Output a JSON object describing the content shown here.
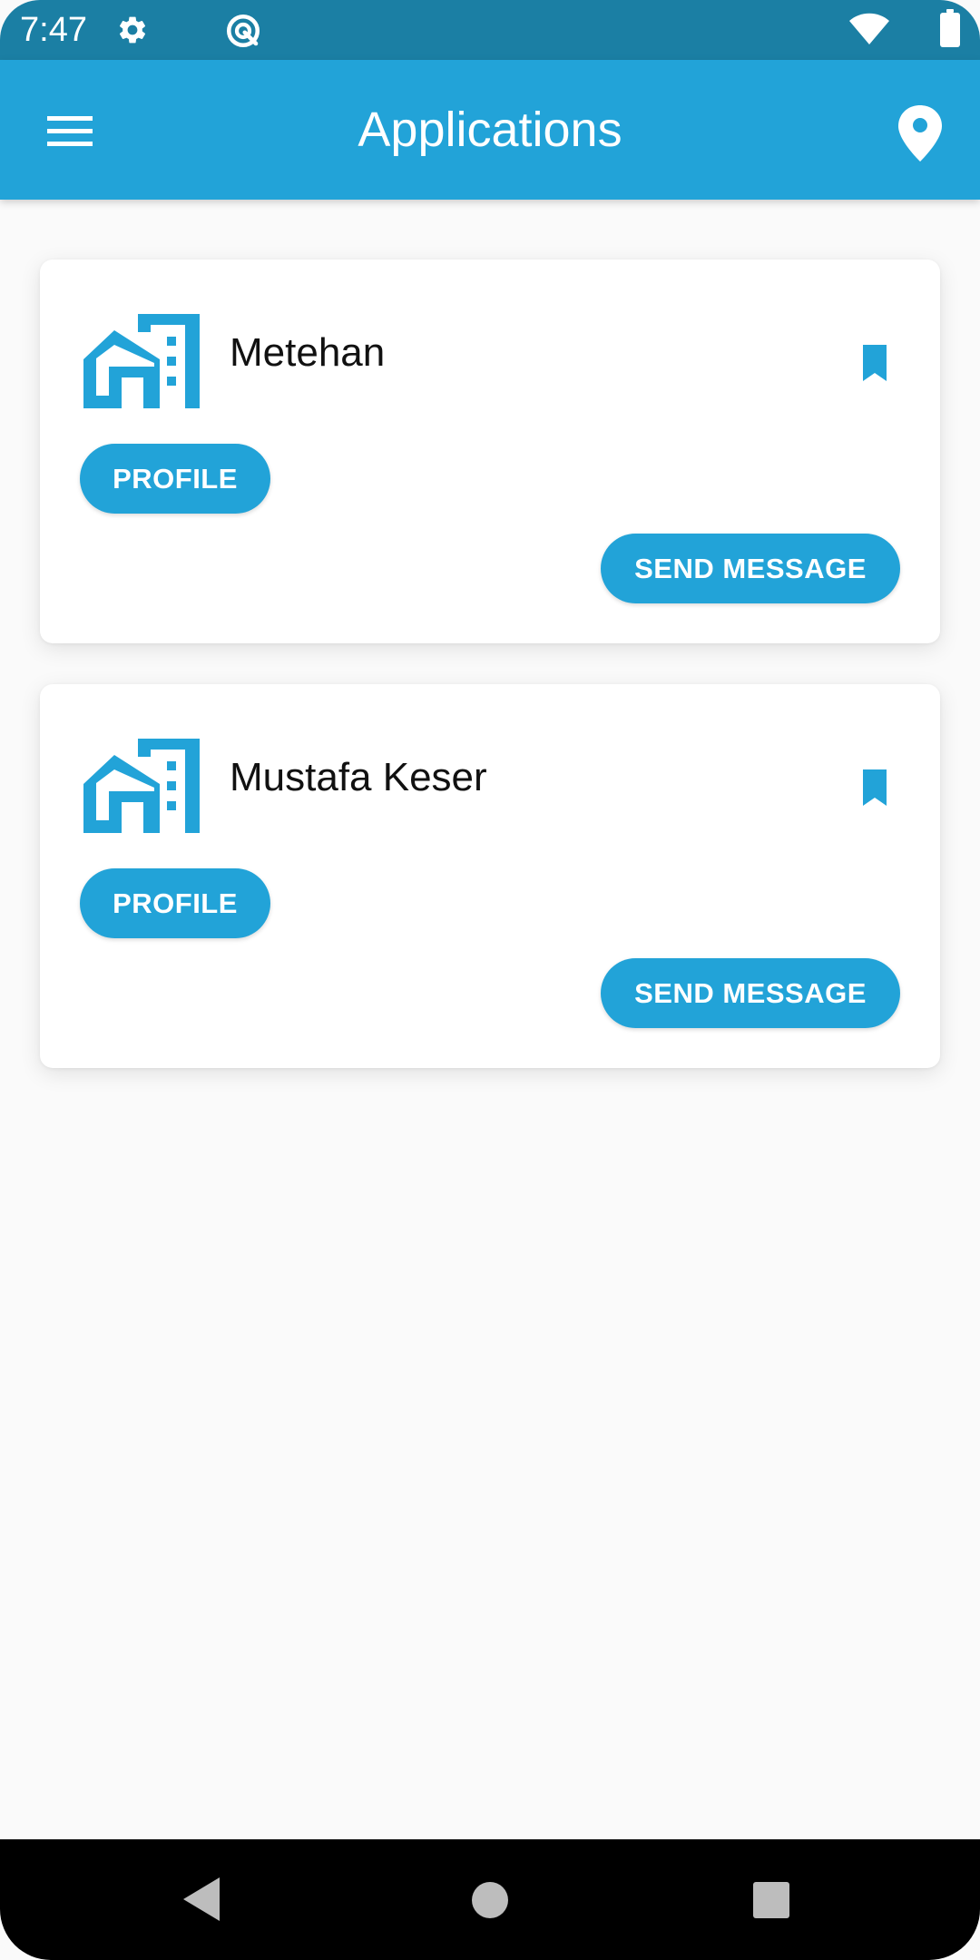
{
  "status_bar": {
    "time": "7:47",
    "icons": [
      "settings-icon",
      "sync-icon",
      "wifi-icon",
      "battery-icon"
    ]
  },
  "app_bar": {
    "title": "Applications",
    "menu_icon": "hamburger-menu-icon",
    "location_icon": "location-pin-icon"
  },
  "applications": [
    {
      "name": "Metehan",
      "icon": "building-icon",
      "bookmark_icon": "bookmark-icon",
      "profile_label": "PROFILE",
      "send_message_label": "SEND MESSAGE"
    },
    {
      "name": "Mustafa Keser",
      "icon": "building-icon",
      "bookmark_icon": "bookmark-icon",
      "profile_label": "PROFILE",
      "send_message_label": "SEND MESSAGE"
    }
  ],
  "nav_bar": {
    "icons": [
      "back-icon",
      "home-icon",
      "recents-icon"
    ]
  },
  "colors": {
    "status_bar": "#1b7fa4",
    "app_bar": "#22a3d8",
    "accent": "#22a3d8",
    "background": "#fafafa",
    "card": "#ffffff",
    "nav_bar": "#000000"
  }
}
